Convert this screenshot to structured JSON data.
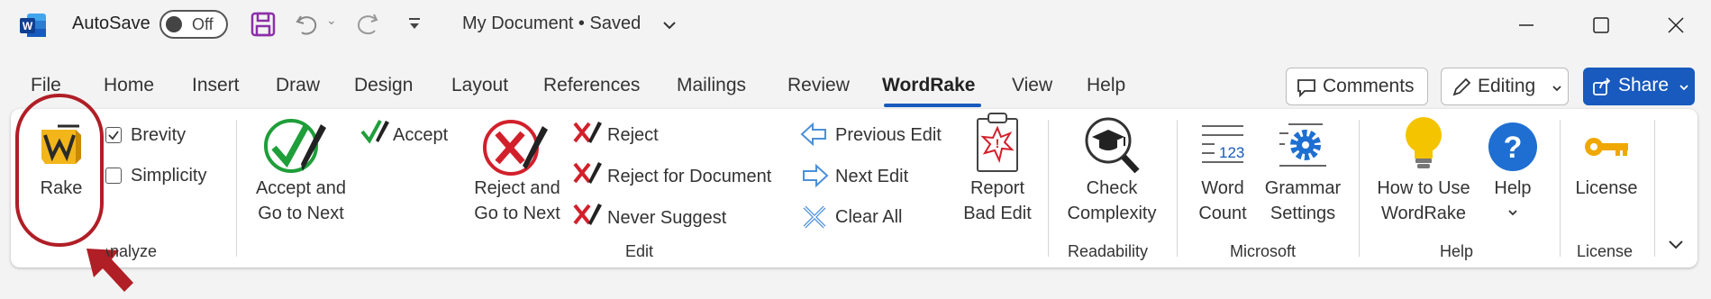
{
  "title_bar": {
    "app_icon": "word-app-icon",
    "autosave_label": "AutoSave",
    "autosave_toggle": "Off",
    "document_title": "My Document • Saved",
    "quick_access": [
      "save-icon",
      "undo-icon",
      "redo-icon",
      "customize-icon"
    ],
    "window_controls": [
      "minimize-icon",
      "maximize-icon",
      "close-icon"
    ]
  },
  "tabs": [
    "File",
    "Home",
    "Insert",
    "Draw",
    "Design",
    "Layout",
    "References",
    "Mailings",
    "Review",
    "WordRake",
    "View",
    "Help"
  ],
  "active_tab": "WordRake",
  "right_controls": {
    "comments": "Comments",
    "editing": "Editing",
    "share": "Share"
  },
  "ribbon": {
    "analyze": {
      "rake": "Rake",
      "brevity": "Brevity",
      "simplicity": "Simplicity",
      "group": "Analyze"
    },
    "edit": {
      "accept_next_line1": "Accept and",
      "accept_next_line2": "Go to Next",
      "accept": "Accept",
      "reject_next_line1": "Reject and",
      "reject_next_line2": "Go to Next",
      "reject": "Reject",
      "reject_document": "Reject for Document",
      "never_suggest": "Never Suggest",
      "previous_edit": "Previous Edit",
      "next_edit": "Next Edit",
      "clear_all": "Clear All",
      "report_line1": "Report",
      "report_line2": "Bad Edit",
      "group": "Edit"
    },
    "readability": {
      "check_line1": "Check",
      "check_line2": "Complexity",
      "group": "Readability"
    },
    "microsoft": {
      "word_count_line1": "Word",
      "word_count_line2": "Count",
      "word_count_icon_text": "123",
      "grammar_line1": "Grammar",
      "grammar_line2": "Settings",
      "group": "Microsoft"
    },
    "help": {
      "how_to_line1": "How to Use",
      "how_to_line2": "WordRake",
      "help_label": "Help",
      "group": "Help"
    },
    "license": {
      "license_label": "License",
      "group": "License"
    }
  },
  "colors": {
    "accent_blue": "#185abd",
    "annotation_red": "#b01e26",
    "check_green": "#1f9e3a",
    "reject_red": "#d2202b",
    "bulb_yellow": "#f5c400",
    "key_gold": "#f0a800"
  }
}
